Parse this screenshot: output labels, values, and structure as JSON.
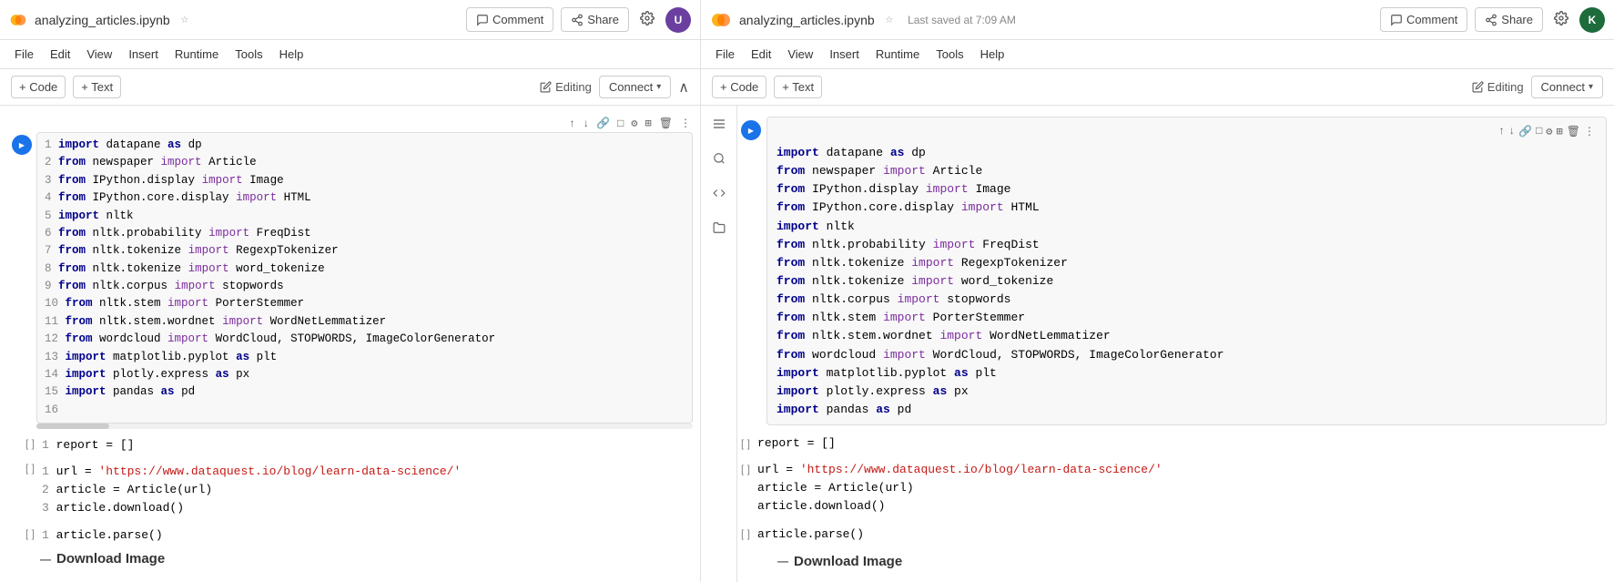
{
  "left": {
    "header": {
      "filename": "analyzing_articles.ipynb",
      "star_icon": "☆",
      "comment_label": "Comment",
      "share_label": "Share",
      "editing_label": "Editing",
      "connect_label": "Connect"
    },
    "toolbar": {
      "code_label": "+ Code",
      "text_label": "+ Text",
      "connect_label": "Connect"
    },
    "cell_toolbar_icons": [
      "↑",
      "↓",
      "🔗",
      "□",
      "⚙",
      "⊞",
      "🗑",
      "⋮"
    ],
    "first_cell": {
      "lines": [
        "1  import datapane as dp",
        "2  from newspaper import Article",
        "3  from IPython.display import Image",
        "4  from IPython.core.display import HTML",
        "5  import nltk",
        "6  from nltk.probability import FreqDist",
        "7  from nltk.tokenize import RegexpTokenizer",
        "8  from nltk.tokenize import word_tokenize",
        "9  from nltk.corpus import stopwords",
        "10 from nltk.stem import PorterStemmer",
        "11 from nltk.stem.wordnet import WordNetLemmatizer",
        "12 from wordcloud import WordCloud, STOPWORDS, ImageColorGenerator",
        "13 import matplotlib.pyplot as plt",
        "14 import plotly.express as px",
        "15 import pandas as pd",
        "16 "
      ]
    },
    "second_cell": {
      "counter": "[ ]",
      "code": "1  report = []"
    },
    "third_cell": {
      "counter": "[ ]",
      "lines": [
        "1  url = 'https://www.dataquest.io/blog/learn-data-science/'",
        "2  article = Article(url)",
        "3  article.download()"
      ],
      "url": "https://www.dataquest.io/blog/learn-data-science/"
    },
    "fourth_cell": {
      "counter": "[ ]",
      "code": "1  article.parse()"
    },
    "section": {
      "title": "Download Image"
    }
  },
  "right": {
    "header": {
      "filename": "analyzing_articles.ipynb",
      "star_icon": "☆",
      "comment_label": "Comment",
      "share_label": "Share",
      "editing_label": "Editing",
      "connect_label": "Connect",
      "saved_info": "Last saved at 7:09 AM"
    },
    "toolbar": {
      "code_label": "+ Code",
      "text_label": "+ Text"
    },
    "first_cell": {
      "lines": [
        "import datapane as dp",
        "from newspaper import Article",
        "from IPython.display import Image",
        "from IPython.core.display import HTML",
        "import nltk",
        "from nltk.probability import FreqDist",
        "from nltk.tokenize import RegexpTokenizer",
        "from nltk.tokenize import word_tokenize",
        "from nltk.corpus import stopwords",
        "from nltk.stem import PorterStemmer",
        "from nltk.stem.wordnet import WordNetLemmatizer",
        "from wordcloud import WordCloud, STOPWORDS, ImageColorGenerator",
        "import matplotlib.pyplot as plt",
        "import plotly.express as px",
        "import pandas as pd"
      ]
    },
    "second_cell": {
      "code": "report = []"
    },
    "third_cell": {
      "lines": [
        "url = 'https://www.dataquest.io/blog/learn-data-science/'",
        "article = Article(url)",
        "article.download()"
      ],
      "url": "https://www.dataquest.io/blog/learn-data-science/"
    },
    "fourth_cell": {
      "code": "article.parse()"
    },
    "section": {
      "title": "Download Image"
    }
  }
}
